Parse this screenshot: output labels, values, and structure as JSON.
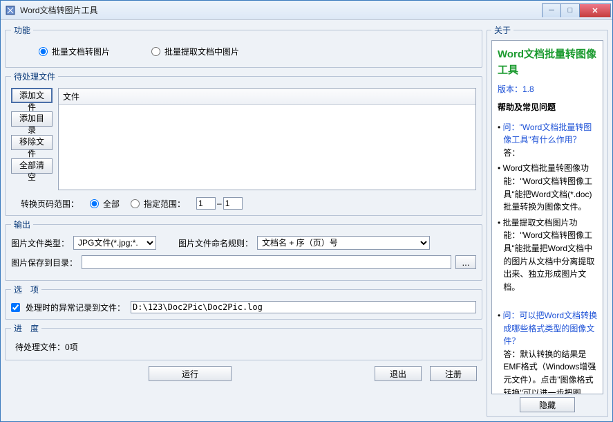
{
  "window": {
    "title": "Word文档转图片工具"
  },
  "func": {
    "legend": "功能",
    "opt1": "批量文档转图片",
    "opt2": "批量提取文档中图片"
  },
  "files": {
    "legend": "待处理文件",
    "add_file": "添加文件",
    "add_dir": "添加目录",
    "remove": "移除文件",
    "clear": "全部清空",
    "col_file": "文件",
    "range_label": "转换页码范围：",
    "range_all": "全部",
    "range_custom": "指定范围：",
    "range_from": "1",
    "range_to": "1"
  },
  "output": {
    "legend": "输出",
    "type_label": "图片文件类型：",
    "type_value": "JPG文件(*.jpg;*.",
    "name_label": "图片文件命名规则：",
    "name_value": "文档名 + 序（页）号",
    "save_label": "图片保存到目录：",
    "save_value": "",
    "browse": "..."
  },
  "options": {
    "legend": "选　项",
    "log_check": "处理时的异常记录到文件：",
    "log_path": "D:\\123\\Doc2Pic\\Doc2Pic.log"
  },
  "progress": {
    "legend": "进　度",
    "text": "待处理文件：0项"
  },
  "buttons": {
    "run": "运行",
    "exit": "退出",
    "register": "注册"
  },
  "about": {
    "legend": "关于",
    "title": "Word文档批量转图像工具",
    "version": "版本：1.8",
    "help_heading": "帮助及常见问题",
    "q1": "问：\"Word文档批量转图像工具\"有什么作用？",
    "a1_label": "答：",
    "a1_b1": "Word文档批量转图像功能：\"Word文档转图像工具\"能把Word文档(*.doc)批量转换为图像文件。",
    "a1_b2": "批量提取文档图片功能：\"Word文档转图像工具\"能批量把Word文档中的图片从文档中分离提取出来、独立形成图片文档。",
    "q2": "问：可以把Word文档转换成哪些格式类型的图像文件？",
    "a2": "答：默认转换的结果是EMF格式（Windows增强元文件）。点击\"图像格式转换\"可以进一步把图",
    "hide": "隐藏"
  }
}
